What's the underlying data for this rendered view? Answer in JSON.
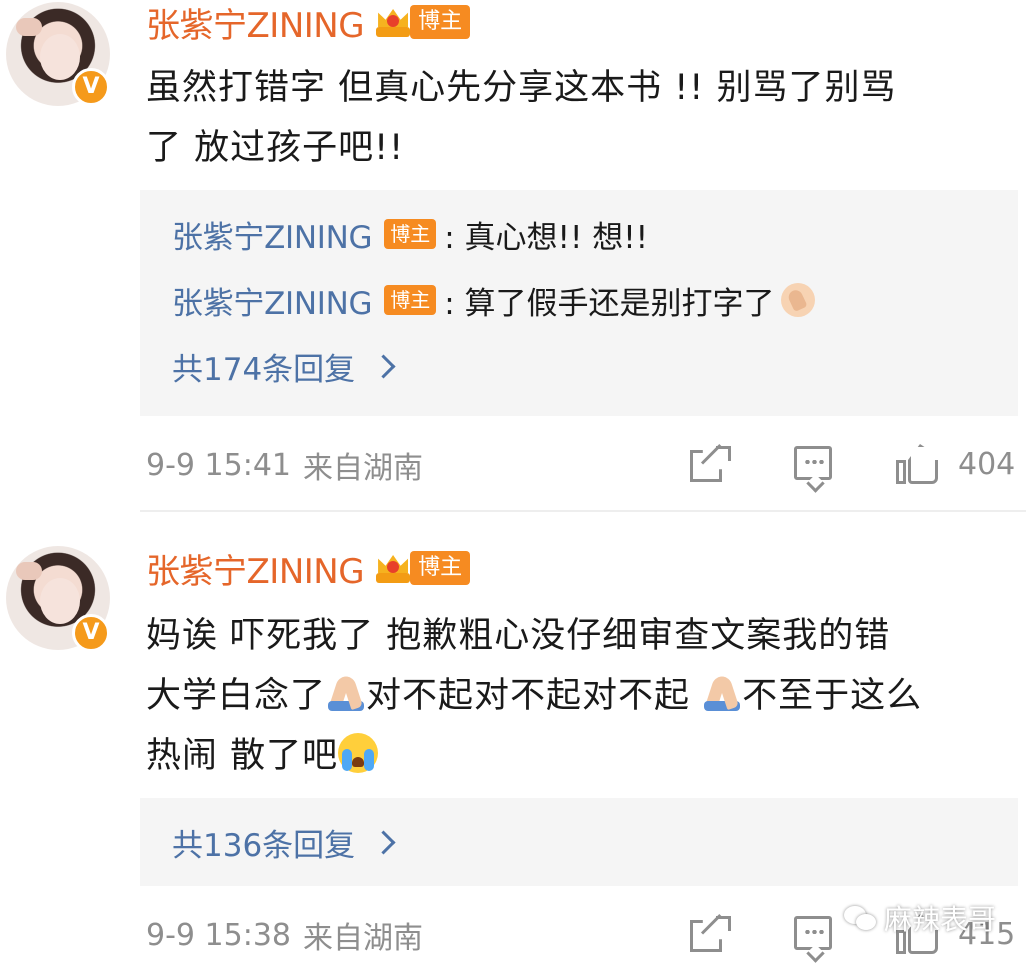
{
  "comments": [
    {
      "username": "张紫宁ZINING",
      "badge": "博主",
      "verified": "V",
      "text_lines": [
        "虽然打错字 但真心先分享这本书 !! 别骂了别骂",
        "了 放过孩子吧!!"
      ],
      "replies": [
        {
          "username": "张紫宁ZINING",
          "badge": "博主",
          "text": ": 真心想!! 想!!"
        },
        {
          "username": "张紫宁ZINING",
          "badge": "博主",
          "text": ": 算了假手还是别打字了",
          "emoji": "clapping-hands-icon"
        }
      ],
      "more_replies": "共174条回复",
      "time": "9-9 15:41",
      "location": "来自湖南",
      "likes": "404"
    },
    {
      "username": "张紫宁ZINING",
      "badge": "博主",
      "verified": "V",
      "text_line1": "妈诶 吓死我了  抱歉粗心没仔细审查文案我的错",
      "text_line2_a": "大学白念了",
      "text_line2_b": "对不起对不起对不起 ",
      "text_line2_c": "不至于这么",
      "text_line3": "热闹 散了吧",
      "more_replies": "共136条回复",
      "time": "9-9 15:38",
      "location": "来自湖南",
      "likes": "415"
    }
  ],
  "watermark": "麻辣表哥",
  "colors": {
    "username": "#e5662a",
    "reply_user": "#4d72a6",
    "badge_bg": "#f68b21",
    "meta_gray": "#8e8e8e",
    "reply_bg": "#f5f5f5"
  }
}
